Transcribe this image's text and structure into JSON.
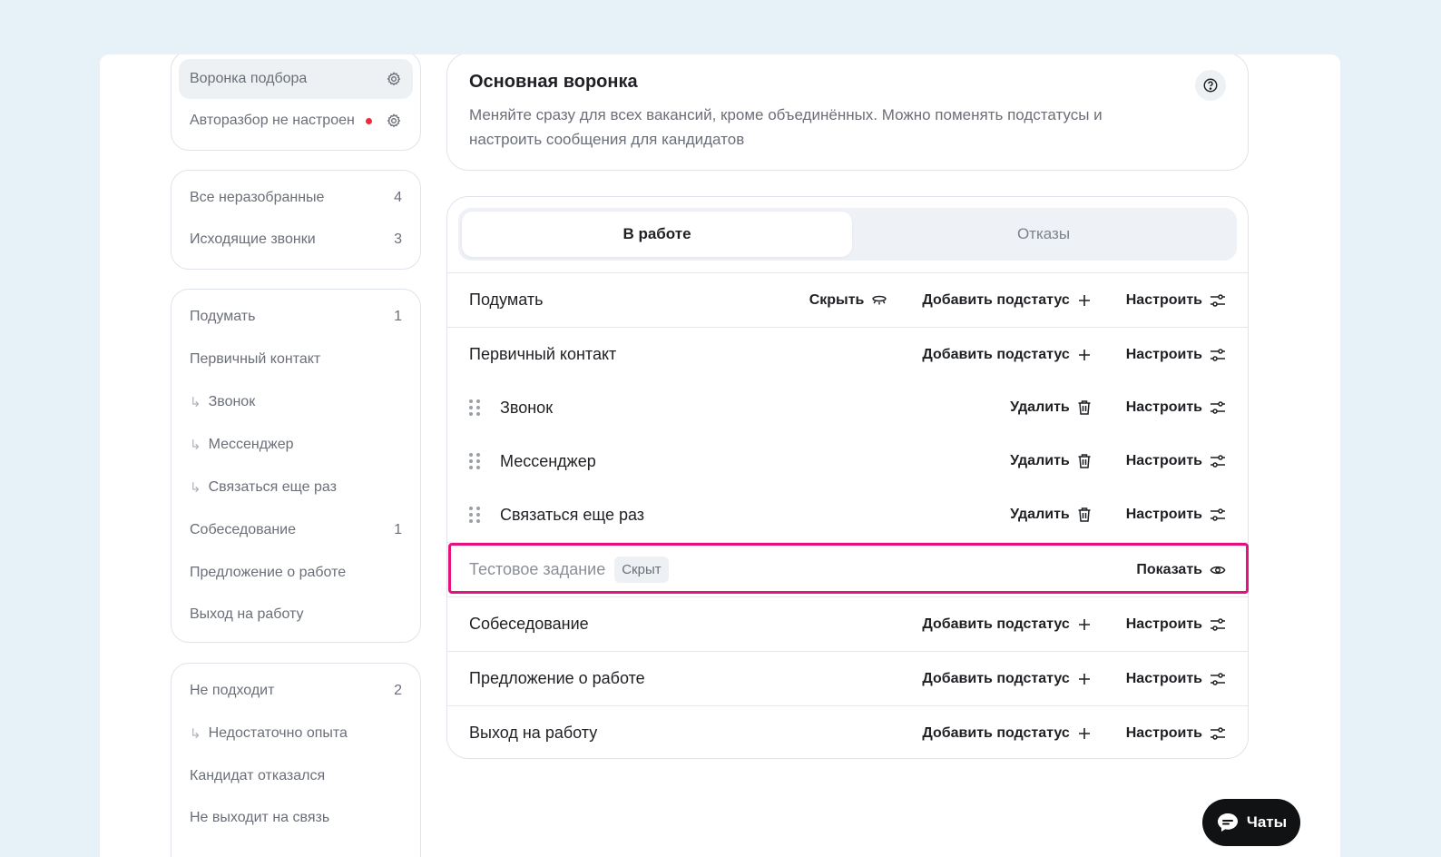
{
  "sidebar": {
    "settings_group": [
      {
        "label": "Воронка подбора",
        "active": true
      },
      {
        "label": "Авторазбор не настроен",
        "alert": true
      }
    ],
    "unsorted_group": [
      {
        "label": "Все неразобранные",
        "count": "4"
      },
      {
        "label": "Исходящие звонки",
        "count": "3"
      }
    ],
    "work_group": [
      {
        "label": "Подумать",
        "count": "1"
      },
      {
        "label": "Первичный контакт",
        "count": ""
      },
      {
        "label": "Звонок",
        "sub": true
      },
      {
        "label": "Мессенджер",
        "sub": true
      },
      {
        "label": "Связаться еще раз",
        "sub": true
      },
      {
        "label": "Собеседование",
        "count": "1"
      },
      {
        "label": "Предложение о работе",
        "count": ""
      },
      {
        "label": "Выход на работу",
        "count": ""
      }
    ],
    "reject_group": [
      {
        "label": "Не подходит",
        "count": "2"
      },
      {
        "label": "Недостаточно опыта",
        "sub": true
      },
      {
        "label": "Кандидат отказался",
        "count": ""
      },
      {
        "label": "Не выходит на связь",
        "count": ""
      }
    ]
  },
  "info": {
    "title": "Основная воронка",
    "description": "Меняйте сразу для всех вакансий, кроме объединённых. Можно поменять подстатусы и настроить сообщения для кандидатов"
  },
  "tabs": {
    "active": "В работе",
    "inactive": "Отказы"
  },
  "actions": {
    "hide": "Скрыть",
    "add_substatus": "Добавить подстатус",
    "configure": "Настроить",
    "delete": "Удалить",
    "show": "Показать"
  },
  "stages": [
    {
      "name": "Подумать",
      "type": "stage",
      "hideable": true
    },
    {
      "name": "Первичный контакт",
      "type": "stage"
    },
    {
      "name": "Звонок",
      "type": "substatus"
    },
    {
      "name": "Мессенджер",
      "type": "substatus"
    },
    {
      "name": "Связаться еще раз",
      "type": "substatus"
    },
    {
      "name": "Тестовое задание",
      "type": "hidden",
      "badge": "Скрыт"
    },
    {
      "name": "Собеседование",
      "type": "stage"
    },
    {
      "name": "Предложение о работе",
      "type": "stage"
    },
    {
      "name": "Выход на работу",
      "type": "stage"
    }
  ],
  "chat_button": "Чаты",
  "colors": {
    "highlight": "#e4117e",
    "alert_dot": "#ef2a3a",
    "background": "#e6f1f8"
  }
}
